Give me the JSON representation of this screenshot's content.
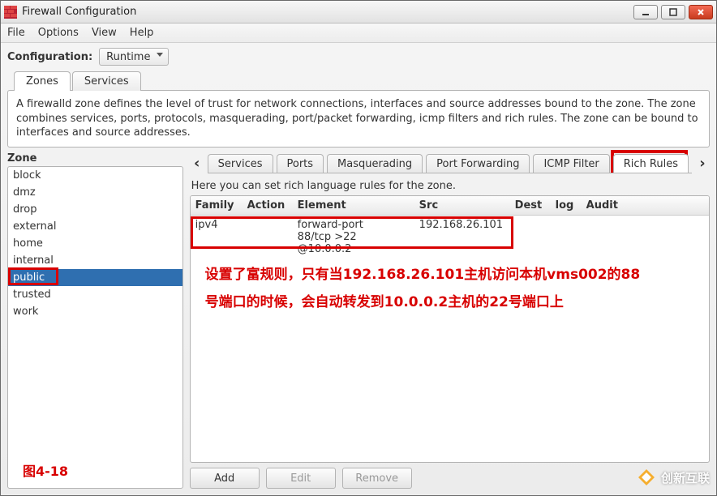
{
  "window": {
    "title": "Firewall Configuration"
  },
  "menubar": {
    "file": "File",
    "options": "Options",
    "view": "View",
    "help": "Help"
  },
  "config": {
    "label": "Configuration:",
    "value": "Runtime"
  },
  "toptabs": {
    "zones": "Zones",
    "services": "Services"
  },
  "description": "A firewalld zone defines the level of trust for network connections, interfaces and source addresses bound to the zone. The zone combines services, ports, protocols, masquerading, port/packet forwarding, icmp filters and rich rules. The zone can be bound to interfaces and source addresses.",
  "zone": {
    "label": "Zone",
    "items": [
      "block",
      "dmz",
      "drop",
      "external",
      "home",
      "internal",
      "public",
      "trusted",
      "work"
    ],
    "selected_index": 6
  },
  "figure_label": "图4-18",
  "subtabs": {
    "items": [
      "Services",
      "Ports",
      "Masquerading",
      "Port Forwarding",
      "ICMP Filter",
      "Rich Rules"
    ],
    "active_index": 5
  },
  "rule_desc": "Here you can set rich language rules for the zone.",
  "columns": {
    "family": "Family",
    "action": "Action",
    "element": "Element",
    "src": "Src",
    "dest": "Dest",
    "log": "log",
    "audit": "Audit"
  },
  "rows": [
    {
      "family": "ipv4",
      "action": "",
      "element": "forward-port\n88/tcp >22 @10.0.0.2",
      "src": "192.168.26.101",
      "dest": "",
      "log": "",
      "audit": ""
    }
  ],
  "annotation": {
    "line1": "设置了富规则，只有当192.168.26.101主机访问本机vms002的88",
    "line2": "号端口的时候，会自动转发到10.0.0.2主机的22号端口上"
  },
  "buttons": {
    "add": "Add",
    "edit": "Edit",
    "remove": "Remove"
  },
  "watermark": "创新互联"
}
